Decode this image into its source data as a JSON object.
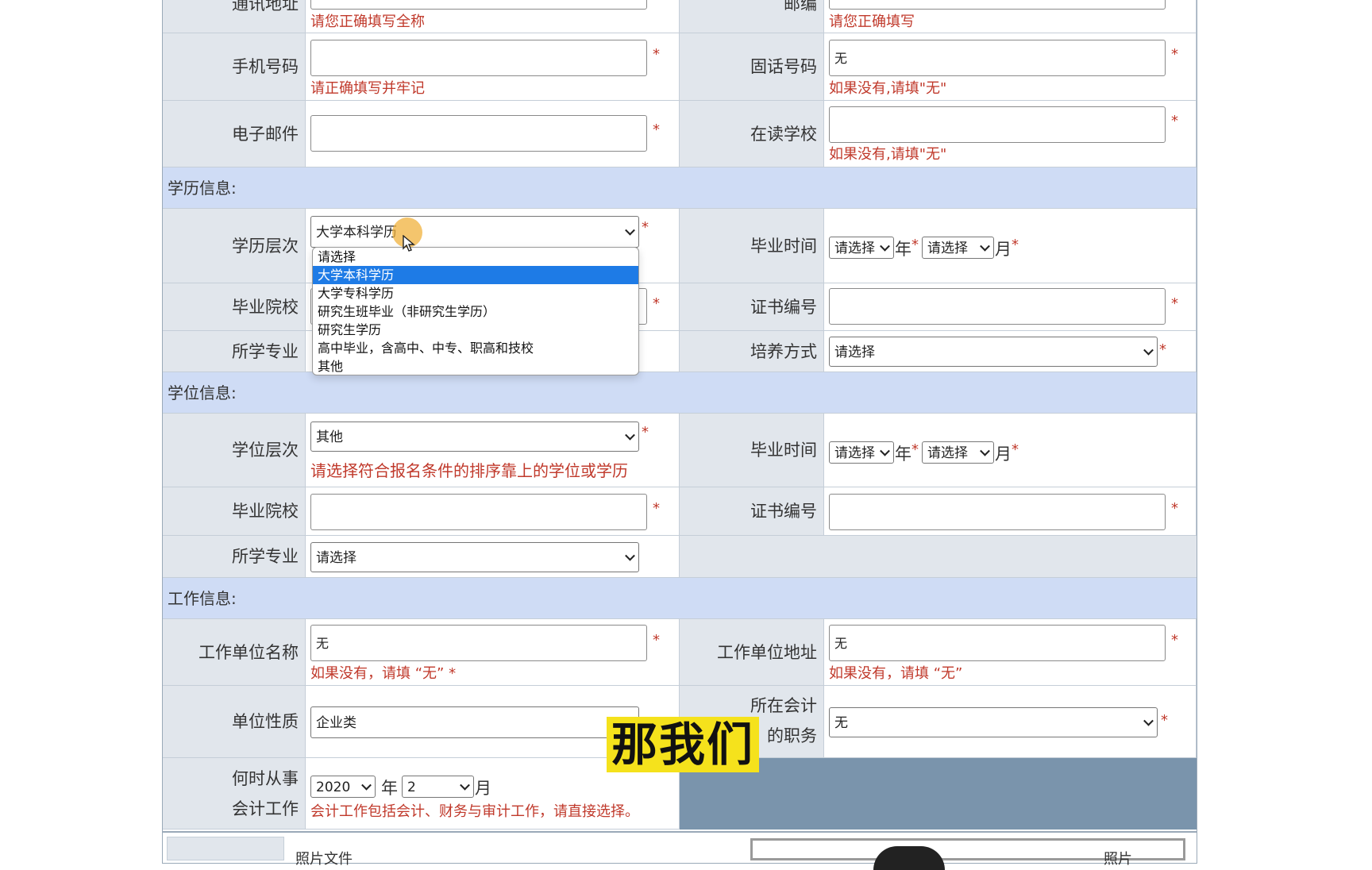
{
  "contact": {
    "address_label": "通讯地址",
    "address_hint": "请您正确填写全称",
    "postcode_label": "邮编",
    "postcode_hint": "请您正确填写",
    "mobile_label": "手机号码",
    "mobile_value": "",
    "mobile_hint": "请正确填写并牢记",
    "landline_label": "固话号码",
    "landline_value": "无",
    "landline_hint": "如果没有,请填\"无\"",
    "email_label": "电子邮件",
    "email_value": "",
    "school_label": "在读学校",
    "school_value": "",
    "school_hint": "如果没有,请填\"无\""
  },
  "education": {
    "section_title": "学历信息:",
    "level_label": "学历层次",
    "level_value": "大学本科学历",
    "grad_time_label": "毕业时间",
    "year_select": "请选择",
    "year_unit": "年",
    "month_select": "请选择",
    "month_unit": "月",
    "school_label": "毕业院校",
    "cert_label": "证书编号",
    "cert_value": "",
    "major_label": "所学专业",
    "training_label": "培养方式",
    "training_value": "请选择",
    "dropdown_options": [
      "请选择",
      "大学本科学历",
      "大学专科学历",
      "研究生班毕业（非研究生学历）",
      "研究生学历",
      "高中毕业，含高中、中专、职高和技校",
      "其他"
    ],
    "dropdown_selected_index": 1
  },
  "degree": {
    "section_title": "学位信息:",
    "level_label": "学位层次",
    "level_value": "其他",
    "level_hint": "请选择符合报名条件的排序靠上的学位或学历",
    "grad_time_label": "毕业时间",
    "year_select": "请选择",
    "year_unit": "年",
    "month_select": "请选择",
    "month_unit": "月",
    "school_label": "毕业院校",
    "school_value": "",
    "cert_label": "证书编号",
    "cert_value": "",
    "major_label": "所学专业",
    "major_value": "请选择"
  },
  "work": {
    "section_title": "工作信息:",
    "unit_name_label": "工作单位名称",
    "unit_name_value": "无",
    "unit_name_hint": "如果没有，请填 “无”  *",
    "unit_addr_label": "工作单位地址",
    "unit_addr_value": "无",
    "unit_addr_hint": "如果没有，请填 “无”",
    "nature_label": "单位性质",
    "nature_value": "企业类",
    "post_label_1": "所在会计",
    "post_label_2": "的职务",
    "post_value": "无",
    "since_label_1": "何时从事",
    "since_label_2": "会计工作",
    "since_year": "2020",
    "since_year_unit": "年",
    "since_month": "2",
    "since_month_unit": "月",
    "since_hint": "会计工作包括会计、财务与审计工作，请直接选择。"
  },
  "photo": {
    "file_label": "照片文件",
    "photo_label": "照片"
  },
  "required_mark": "*",
  "caption": "那我们",
  "colors": {
    "section_bg": "#cfdcf5",
    "label_bg": "#e1e6ec",
    "hint_red": "#c0392b",
    "select_blue": "#1e7be6",
    "caption_yellow": "#f5e21c",
    "photo_panel": "#7a94ac"
  }
}
